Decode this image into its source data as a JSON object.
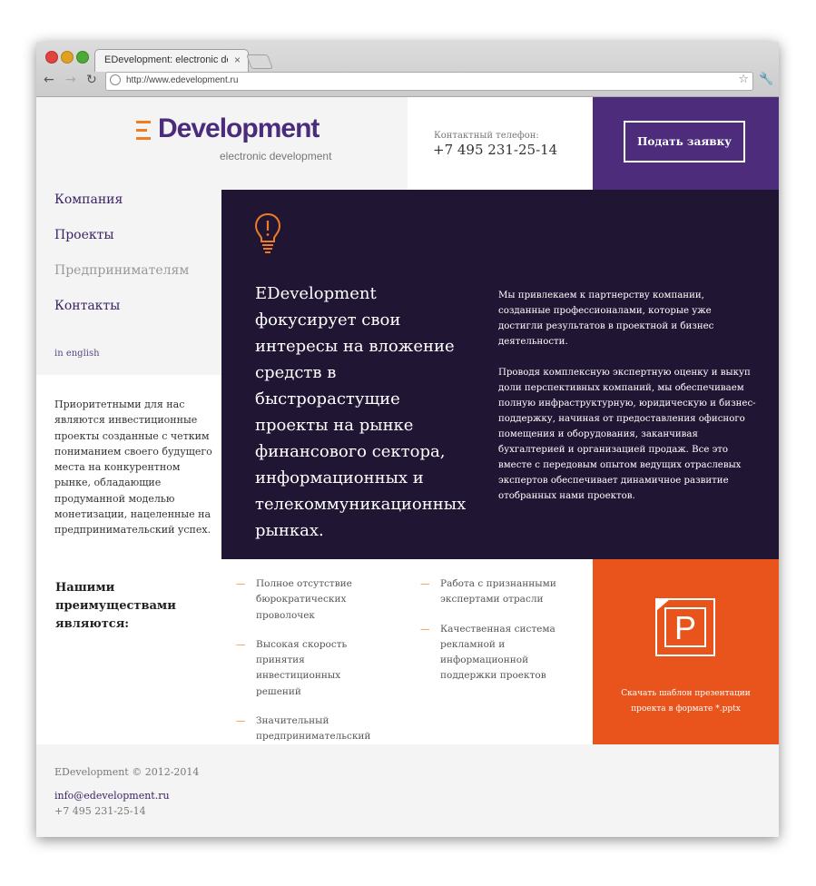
{
  "browser": {
    "tab_title": "EDevelopment: electronic development",
    "tab_close": "×",
    "url": "http://www.edevelopment.ru",
    "back": "←",
    "forward": "→",
    "reload": "↻",
    "star": "☆",
    "wrench": "🔧"
  },
  "header": {
    "logo_text": "Development",
    "logo_sub": "electronic development",
    "contact_label": "Контактный телефон:",
    "contact_phone": "+7 495 231-25-14",
    "cta_label": "Подать заявку"
  },
  "nav": {
    "items": [
      {
        "label": "Компания",
        "active": true
      },
      {
        "label": "Проекты",
        "active": true
      },
      {
        "label": "Предпринимателям",
        "active": false
      },
      {
        "label": "Контакты",
        "active": true
      }
    ],
    "lang": "in english"
  },
  "hero": {
    "heading": "EDevelopment фокусирует свои интересы на вложение средств в быстрорастущие проекты на рынке финансового сектора, информационных и телекоммуникационных рынках.",
    "paragraph1": "Мы привлекаем к партнерству компании, созданные профессионалами, которые уже достигли результатов в проектной и бизнес деятельности.",
    "paragraph2": "Проводя комплексную экспертную оценку и выкуп доли перспективных компаний, мы обеспечиваем полную инфраструктурную, юридическую и бизнес-поддержку, начиная от предоставления офисного помещения и оборудования,  заканчивая бухгалтерией и организацией продаж. Все это вместе с передовым опытом ведущих отраслевых экспертов обеспечивает динамичное развитие отобранных нами проектов."
  },
  "intro": "Приоритетными для нас являются инвестиционные проекты  созданные с четким пониманием своего будущего места на конкурентном рынке, обладающие продуманной моделью монетизации, нацеленные на предпринимательский успех.",
  "advantages": {
    "title": "Нашими преимуществами являются:",
    "dash": "—",
    "col1": [
      "Полное отсутствие бюрократических проволочек",
      "Высокая скорость принятия инвестиционных решений",
      "Значительный предпринимательский и профессиональный опыт"
    ],
    "col2": [
      "Работа с признанными экспертами отрасли",
      "Качественная система рекламной и информационной поддержки проектов"
    ]
  },
  "download": {
    "icon_letter": "P",
    "text": "Скачать шаблон презентации проекта в формате *.pptx"
  },
  "footer": {
    "copyright": "EDevelopment © 2012-2014",
    "email": "info@edevelopment.ru",
    "phone": "+7 495 231-25-14"
  },
  "colors": {
    "purple": "#4d2c7b",
    "dark": "#201634",
    "orange": "#e8541c",
    "accent": "#ee7c22",
    "light_gray": "#f4f4f4"
  }
}
